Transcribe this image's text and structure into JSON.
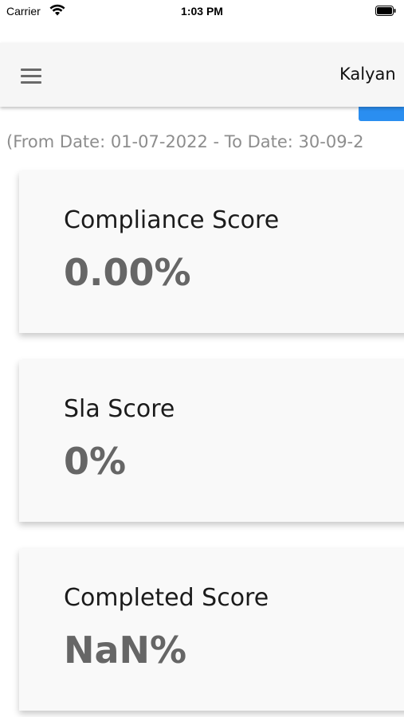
{
  "status_bar": {
    "carrier": "Carrier",
    "time": "1:03 PM",
    "wifi_icon": "wifi-icon",
    "battery_icon": "battery-icon"
  },
  "app_bar": {
    "menu_icon": "hamburger-menu-icon",
    "title": "Kalyan"
  },
  "date_range": "(From Date: 01-07-2022 - To Date: 30-09-2",
  "cards": [
    {
      "label": "Compliance Score",
      "value": "0.00%"
    },
    {
      "label": "Sla Score",
      "value": "0%"
    },
    {
      "label": "Completed Score",
      "value": "NaN%"
    }
  ],
  "colors": {
    "accent_blue": "#2a8ef0",
    "value_text": "#666666",
    "date_text": "#8d8d8d"
  }
}
